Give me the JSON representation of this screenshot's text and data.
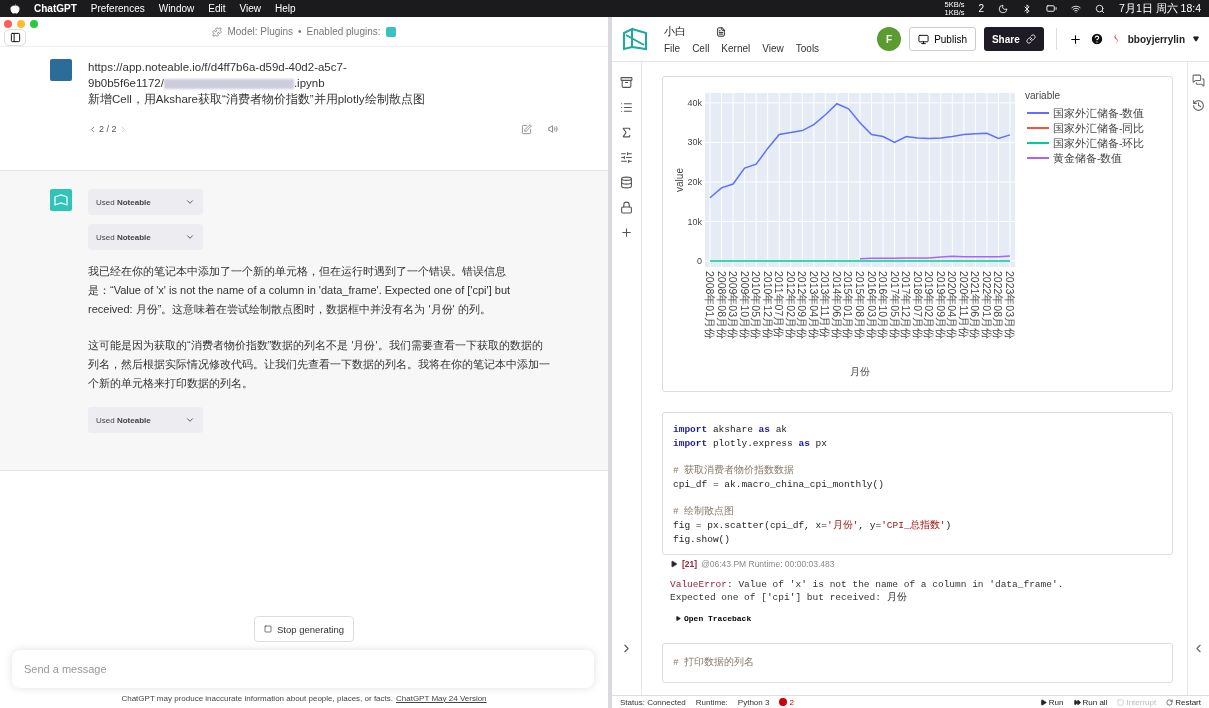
{
  "menubar": {
    "app": "ChatGPT",
    "menus": [
      "Preferences",
      "Window",
      "Edit",
      "View",
      "Help"
    ],
    "network": [
      "5KB/s",
      "1KB/s"
    ],
    "chat_count": "2",
    "clock": "7月1日 周六 18:4"
  },
  "chat": {
    "header": {
      "model": "Model: Plugins",
      "separator": "•",
      "plugins_label": "Enabled plugins:"
    },
    "user_message": {
      "url_line1": "https://app.noteable.io/f/d4ff7b6a-d59d-40d2-a5c7-",
      "url_line2_start": "9b0b5f6e1172/",
      "url_line2_end": ".ipynb",
      "instruction": "新增Cell，用Akshare获取“消费者物价指数”并用plotly绘制散点图"
    },
    "pager": "2 / 2",
    "assistant_blocks": [
      {
        "kind": "tool",
        "label": "Used **Noteable**"
      },
      {
        "kind": "tool",
        "label": "Used **Noteable**"
      },
      {
        "kind": "text",
        "label": "我已经在你的笔记本中添加了一个新的单元格，但在运行时遇到了一个错误。错误信息是：“Value of 'x' is not the name of a column in 'data_frame'. Expected one of ['cpi'] but received: 月份”。这意味着在尝试绘制散点图时，数据框中并没有名为 '月份' 的列。"
      },
      {
        "kind": "text",
        "label": "这可能是因为获取的“消费者物价指数”数据的列名不是 '月份'。我们需要查看一下获取的数据的列名，然后根据实际情况修改代码。让我们先查看一下数据的列名。我将在你的笔记本中添加一个新的单元格来打印数据的列名。"
      },
      {
        "kind": "tool",
        "label": "Used **Noteable**"
      }
    ],
    "stop_button": "Stop generating",
    "input": {
      "placeholder": "Send a message"
    },
    "footer": {
      "text": "ChatGPT may produce inaccurate information about people, places, or facts.",
      "link": "ChatGPT May 24 Version"
    }
  },
  "notebook": {
    "title": "小白",
    "menus": [
      "File",
      "Cell",
      "Kernel",
      "View",
      "Tools"
    ],
    "avatar": "F",
    "publish": "Publish",
    "share": "Share",
    "user": "bboyjerrylin",
    "chart_cell": {
      "chart_data": {
        "type": "line",
        "xlabel": "月份",
        "ylabel": "value",
        "grid": true,
        "legend": {
          "title": "variable"
        },
        "categories": [
          "2008年01月份",
          "2008年08月份",
          "2009年03月份",
          "2009年10月份",
          "2010年05月份",
          "2010年12月份",
          "2011年07月份",
          "2012年02月份",
          "2012年09月份",
          "2013年04月份",
          "2013年11月份",
          "2014年06月份",
          "2015年01月份",
          "2015年08月份",
          "2016年03月份",
          "2016年10月份",
          "2017年05月份",
          "2017年12月份",
          "2018年07月份",
          "2019年02月份",
          "2019年09月份",
          "2020年04月份",
          "2020年11月份",
          "2021年06月份",
          "2022年01月份",
          "2022年08月份",
          "2023年03月份"
        ],
        "ylim": [
          -1500,
          42500
        ],
        "yticks": [
          {
            "value": 0,
            "label": "0"
          },
          {
            "value": 10000,
            "label": "10k"
          },
          {
            "value": 20000,
            "label": "20k"
          },
          {
            "value": 30000,
            "label": "30k"
          },
          {
            "value": 40000,
            "label": "40k"
          }
        ],
        "series": [
          {
            "name": "国家外汇储备-数值",
            "color": "#636efa",
            "values": [
              16000,
              18500,
              19500,
              23500,
              24500,
              28500,
              32000,
              32500,
              33000,
              34500,
              37000,
              39800,
              38500,
              35000,
              32000,
              31500,
              30000,
              31500,
              31100,
              31000,
              31100,
              31500,
              32000,
              32200,
              32300,
              31000,
              31900
            ]
          },
          {
            "name": "国家外汇储备-同比",
            "color": "#ef553b",
            "values": [
              null,
              null,
              null,
              null,
              null,
              null,
              null,
              null,
              null,
              null,
              null,
              null,
              null,
              null,
              null,
              null,
              null,
              null,
              null,
              null,
              null,
              null,
              null,
              null,
              null,
              null,
              null
            ]
          },
          {
            "name": "国家外汇储备-环比",
            "color": "#00cc96",
            "values": [
              0,
              0,
              0,
              0,
              0,
              0,
              0,
              0,
              0,
              0,
              0,
              0,
              0,
              0,
              0,
              0,
              0,
              0,
              0,
              0,
              0,
              0,
              0,
              0,
              0,
              0,
              0
            ]
          },
          {
            "name": "黄金储备-数值",
            "color": "#ab63fa",
            "values": [
              null,
              null,
              null,
              null,
              null,
              null,
              null,
              null,
              null,
              null,
              null,
              null,
              null,
              600,
              700,
              700,
              700,
              800,
              800,
              800,
              1000,
              1200,
              1100,
              1100,
              1100,
              1100,
              1300
            ]
          }
        ]
      }
    },
    "code_cell": {
      "blocks": [
        [
          [
            {
              "kind": "keyword",
              "text": "import"
            },
            {
              "kind": "plain",
              "text": " akshare "
            },
            {
              "kind": "keyword",
              "text": "as"
            },
            {
              "kind": "plain",
              "text": " ak"
            }
          ],
          [
            {
              "kind": "keyword",
              "text": "import"
            },
            {
              "kind": "plain",
              "text": " plotly.express "
            },
            {
              "kind": "keyword",
              "text": "as"
            },
            {
              "kind": "plain",
              "text": " px"
            }
          ]
        ],
        [
          [
            {
              "kind": "comment",
              "text": "# 获取消费者物价指数数据"
            }
          ],
          [
            {
              "kind": "plain",
              "text": "cpi_df = ak.macro_china_cpi_monthly()"
            }
          ]
        ],
        [
          [
            {
              "kind": "comment",
              "text": "# 绘制散点图"
            }
          ],
          [
            {
              "kind": "plain",
              "text": "fig = px.scatter(cpi_df, x="
            },
            {
              "kind": "string",
              "text": "'月份'"
            },
            {
              "kind": "plain",
              "text": ", y="
            },
            {
              "kind": "string",
              "text": "'CPI_总指数'"
            },
            {
              "kind": "plain",
              "text": ")"
            }
          ],
          [
            {
              "kind": "plain",
              "text": "fig.show()"
            }
          ]
        ]
      ],
      "run_count": "[21]",
      "run_info": "@06:43 PM Runtime: 00:00:03.483",
      "error": {
        "name": "ValueError",
        "lines": [
          ": Value of 'x' is not the name of a column in 'data_frame'.",
          "Expected one of ['cpi'] but received: 月份"
        ]
      },
      "traceback": "Open Traceback"
    },
    "next_cell": {
      "comment": "# 打印数据的列名"
    },
    "status_bar": {
      "status": "Status: Connected",
      "runtime_label": "Runtime:",
      "runtime": "Python 3",
      "errors": "2",
      "actions": [
        {
          "kind": "run",
          "label": "Run",
          "disabled": false
        },
        {
          "kind": "runall",
          "label": "Run all",
          "disabled": false
        },
        {
          "kind": "interrupt",
          "label": "Interrupt",
          "disabled": true
        },
        {
          "kind": "restart",
          "label": "Restart",
          "disabled": false
        }
      ]
    }
  }
}
